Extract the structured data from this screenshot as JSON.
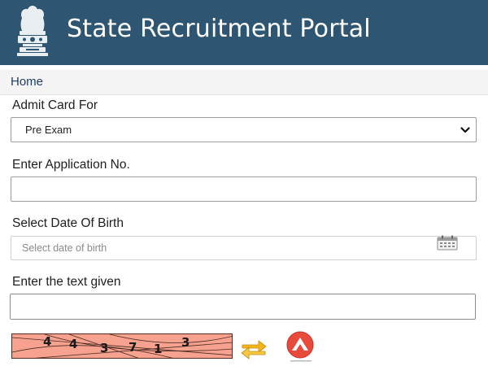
{
  "header": {
    "title": "State Recruitment Portal",
    "emblem_icon": "state-emblem-icon",
    "background": "#2e5672"
  },
  "breadcrumb": {
    "home": "Home"
  },
  "form": {
    "admit_card_label": "Admit Card For",
    "admit_card_value": "Pre Exam",
    "application_label": "Enter Application No.",
    "application_value": "",
    "dob_label": "Select Date Of Birth",
    "dob_placeholder": "Select date of birth",
    "captcha_label": "Enter the text given",
    "captcha_value": ""
  },
  "captcha": {
    "digits": [
      "4",
      "4",
      "3",
      "7",
      "1",
      "3"
    ],
    "background": "#f6a28e",
    "refresh_icon": "refresh-arrows-icon",
    "audio_icon": "audio-captcha-icon"
  }
}
